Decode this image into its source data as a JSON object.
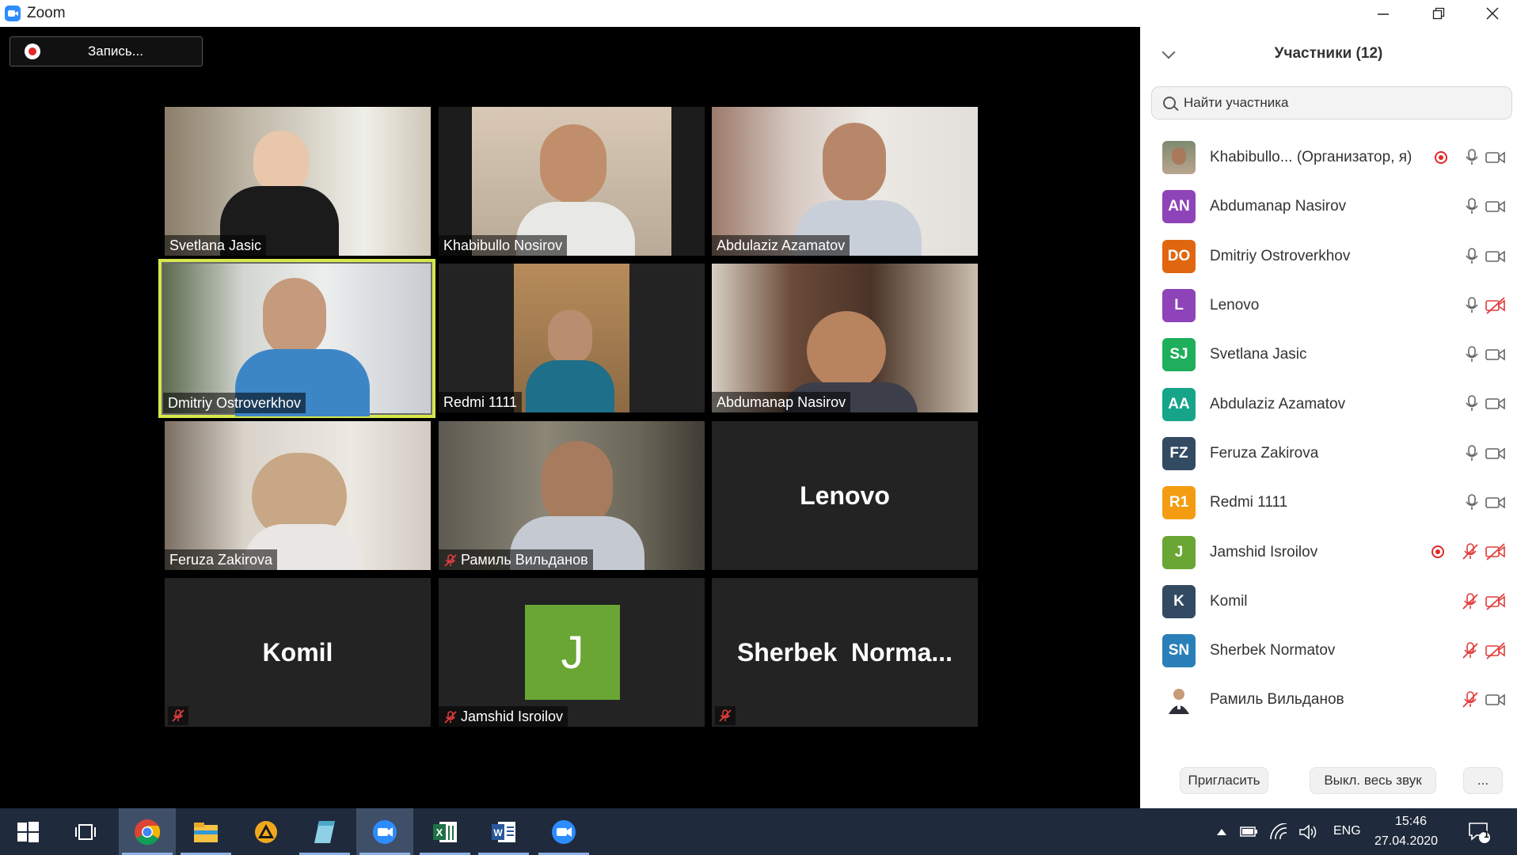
{
  "window": {
    "title": "Zoom"
  },
  "recording": {
    "label": "Запись..."
  },
  "tiles": [
    {
      "name": "Svetlana Jasic",
      "muted": false
    },
    {
      "name": "Khabibullo Nosirov",
      "muted": false
    },
    {
      "name": "Abdulaziz Azamatov",
      "muted": false
    },
    {
      "name": "Dmitriy Ostroverkhov",
      "muted": false,
      "active_speaker": true
    },
    {
      "name": "Redmi 1111",
      "muted": false
    },
    {
      "name": "Abdumanap Nasirov",
      "muted": false
    },
    {
      "name": "Feruza Zakirova",
      "muted": false
    },
    {
      "name": "Рамиль Вильданов",
      "muted": true
    },
    {
      "name": "Lenovo",
      "video_off": true
    },
    {
      "name": "Komil",
      "video_off": true,
      "muted": true
    },
    {
      "name": "Jamshid Isroilov",
      "avatar_letter": "J",
      "muted": true
    },
    {
      "name": "Sherbek  Norma...",
      "video_off": true,
      "muted": true
    }
  ],
  "participants_panel": {
    "title": "Участники (12)",
    "search_placeholder": "Найти участника",
    "participants": [
      {
        "initials": "",
        "name": "Khabibullo...  (Организатор, я)",
        "color": "#8a8f7a",
        "photo": true,
        "recording": true,
        "mic": "on",
        "video": "on"
      },
      {
        "initials": "AN",
        "name": "Abdumanap Nasirov",
        "color": "#8e44b8",
        "mic": "on",
        "video": "on"
      },
      {
        "initials": "DO",
        "name": "Dmitriy Ostroverkhov",
        "color": "#e0660f",
        "mic": "on",
        "video": "on"
      },
      {
        "initials": "L",
        "name": "Lenovo",
        "color": "#8e44b8",
        "mic": "on",
        "video": "off"
      },
      {
        "initials": "SJ",
        "name": "Svetlana Jasic",
        "color": "#1fae5b",
        "mic": "on",
        "video": "on"
      },
      {
        "initials": "AA",
        "name": "Abdulaziz Azamatov",
        "color": "#17a58a",
        "mic": "on",
        "video": "on"
      },
      {
        "initials": "FZ",
        "name": "Feruza Zakirova",
        "color": "#334a63",
        "mic": "on",
        "video": "on"
      },
      {
        "initials": "R1",
        "name": "Redmi 1111",
        "color": "#f39c12",
        "mic": "on",
        "video": "on"
      },
      {
        "initials": "J",
        "name": "Jamshid Isroilov",
        "color": "#6aa633",
        "recording": true,
        "mic": "off",
        "video": "off"
      },
      {
        "initials": "K",
        "name": "Komil",
        "color": "#334a63",
        "mic": "off",
        "video": "off"
      },
      {
        "initials": "SN",
        "name": "Sherbek Normatov",
        "color": "#2a7fb8",
        "mic": "off",
        "video": "off"
      },
      {
        "initials": "",
        "name": "Рамиль Вильданов",
        "color": "#ffffff",
        "photo": true,
        "mic": "off",
        "video": "on"
      }
    ],
    "invite_label": "Пригласить",
    "mute_all_label": "Выкл. весь звук",
    "more_label": "..."
  },
  "taskbar": {
    "language": "ENG",
    "time": "15:46",
    "date": "27.04.2020",
    "notifications": "1",
    "apps": [
      "start-icon",
      "task-view-icon",
      "chrome-icon",
      "file-explorer-icon",
      "unknown-app-icon",
      "notepad-icon",
      "zoom-icon",
      "excel-icon",
      "word-icon",
      "zoom-icon"
    ]
  }
}
